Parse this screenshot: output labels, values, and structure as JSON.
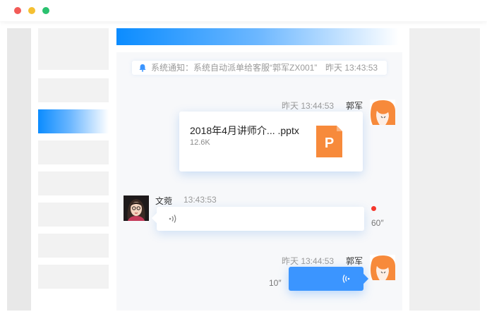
{
  "window": {
    "controls": [
      "close",
      "minimize",
      "maximize"
    ],
    "colors": {
      "close": "#f25b57",
      "minimize": "#f5c032",
      "maximize": "#2ac16f"
    }
  },
  "sidebar": {
    "item_count": 8,
    "active_index": 2,
    "accent": "#0b8cff"
  },
  "chat": {
    "system_notice": {
      "icon": "bell-icon",
      "text": "系统通知：系统自动派单给客服“郭军ZX001”",
      "time": "昨天 13:43:53"
    },
    "messages": [
      {
        "sender": "郭军",
        "time": "昨天 13:44:53",
        "direction": "outgoing",
        "type": "file",
        "file_name": "2018年4月讲师介... .pptx",
        "file_size": "12.6K",
        "file_icon": "ppt-file-icon",
        "file_icon_letter": "P"
      },
      {
        "sender": "文菀",
        "time": "13:43:53",
        "direction": "incoming",
        "type": "voice",
        "duration": "60″",
        "unread": true
      },
      {
        "sender": "郭军",
        "time": "昨天 13:44:53",
        "direction": "outgoing",
        "type": "voice",
        "duration": "10″"
      }
    ]
  },
  "colors": {
    "brand_blue": "#3b95ff",
    "ppt_orange": "#f78a3b",
    "unread_red": "#f5372d"
  }
}
